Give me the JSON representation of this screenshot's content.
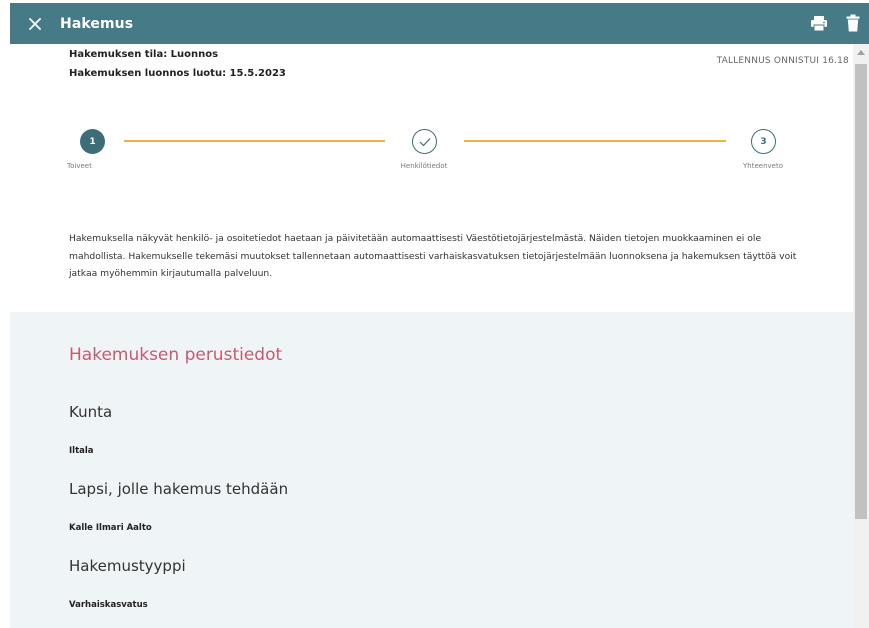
{
  "header": {
    "title": "Hakemus",
    "bg_color": "#457a86"
  },
  "meta": {
    "status": "Hakemuksen tila: Luonnos",
    "created": "Hakemuksen luonnos luotu: 15.5.2023",
    "saved": "TALLENNUS ONNISTUI 16.18"
  },
  "stepper": {
    "steps": [
      {
        "number": "1",
        "label": "Toiveet",
        "state": "active"
      },
      {
        "number": "",
        "label": "Henkilötiedot",
        "state": "done"
      },
      {
        "number": "3",
        "label": "Yhteenveto",
        "state": "todo"
      }
    ],
    "line_color": "#f0b04a"
  },
  "info_text": "Hakemuksella näkyvät henkilö- ja osoitetiedot haetaan ja päivitetään automaattisesti Väestötietojärjestelmästä. Näiden tietojen muokkaaminen ei ole mahdollista. Hakemukselle tekemäsi muutokset tallennetaan automaattisesti varhaiskasvatuksen tietojärjestelmään luonnoksena ja hakemuksen täyttöä voit jatkaa myöhemmin kirjautumalla palveluun.",
  "basic_info": {
    "title": "Hakemuksen perustiedot",
    "title_color": "#c75a6e",
    "fields": [
      {
        "label": "Kunta",
        "value": "Iltala"
      },
      {
        "label": "Lapsi, jolle hakemus tehdään",
        "value": "Kalle Ilmari Aalto"
      },
      {
        "label": "Hakemustyyppi",
        "value": "Varhaiskasvatus"
      }
    ]
  }
}
